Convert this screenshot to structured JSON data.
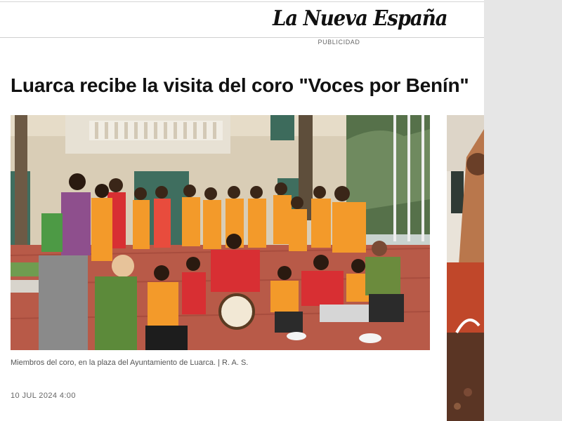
{
  "header": {
    "logo_text": "La Nueva España",
    "ad_label": "PUBLICIDAD"
  },
  "article": {
    "headline": "Luarca recibe la visita del coro \"Voces por Benín\"",
    "photo_alt": "Miembros del coro, en la plaza del Ayuntamiento de Luarca.",
    "caption": "Miembros del coro, en la plaza del Ayuntamiento de Luarca. | R. A. S.",
    "date": "10 JUL 2024 4:00"
  },
  "colors": {
    "shirt_orange": "#f39a2a",
    "hoodie_red": "#d82f33",
    "pavement": "#b85a48",
    "building": "#d9cdb6"
  }
}
